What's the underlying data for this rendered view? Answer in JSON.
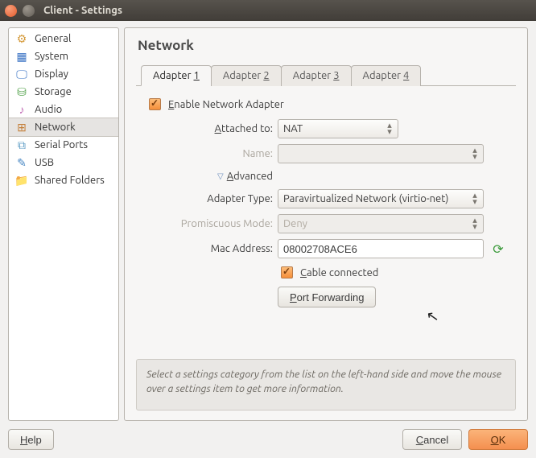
{
  "window": {
    "title": "Client - Settings"
  },
  "sidebar": {
    "items": [
      {
        "label": "General",
        "icon": "⚙",
        "color": "#d59a3a"
      },
      {
        "label": "System",
        "icon": "▦",
        "color": "#3a73c4"
      },
      {
        "label": "Display",
        "icon": "🖵",
        "color": "#3a73c4"
      },
      {
        "label": "Storage",
        "icon": "⛁",
        "color": "#5aa653"
      },
      {
        "label": "Audio",
        "icon": "♪",
        "color": "#c06ab4"
      },
      {
        "label": "Network",
        "icon": "⊞",
        "color": "#c47f3a"
      },
      {
        "label": "Serial Ports",
        "icon": "⧉",
        "color": "#5b9bc4"
      },
      {
        "label": "USB",
        "icon": "✎",
        "color": "#4a88c4"
      },
      {
        "label": "Shared Folders",
        "icon": "📁",
        "color": "#4a88c4"
      }
    ],
    "selected_index": 5
  },
  "page": {
    "title": "Network"
  },
  "tabs": [
    {
      "prefix": "Adapter ",
      "num": "1"
    },
    {
      "prefix": "Adapter ",
      "num": "2"
    },
    {
      "prefix": "Adapter ",
      "num": "3"
    },
    {
      "prefix": "Adapter ",
      "num": "4"
    }
  ],
  "active_tab": 0,
  "form": {
    "enable_label_pre": "E",
    "enable_label_post": "nable Network Adapter",
    "enable_checked": true,
    "attached_pre": "A",
    "attached_post": "ttached to:",
    "attached_value": "NAT",
    "name_label": "Name:",
    "name_value": "",
    "advanced_pre": "A",
    "advanced_post": "dvanced",
    "adapter_type_label": "Adapter Type:",
    "adapter_type_value": "Paravirtualized Network (virtio-net)",
    "promiscuous_label": "Promiscuous Mode:",
    "promiscuous_value": "Deny",
    "mac_label": "Mac Address:",
    "mac_value": "08002708ACE6",
    "cable_pre": "C",
    "cable_post": "able connected",
    "cable_checked": true,
    "port_fwd_pre": "P",
    "port_fwd_post": "ort Forwarding"
  },
  "hint": "Select a settings category from the list on the left-hand side and move the mouse over a settings item to get more information.",
  "buttons": {
    "help_pre": "H",
    "help_post": "elp",
    "cancel_pre": "C",
    "cancel_post": "ancel",
    "ok_pre": "O",
    "ok_post": "K"
  }
}
